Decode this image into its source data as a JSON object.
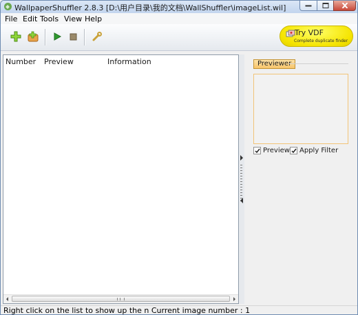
{
  "window": {
    "title": "WallpaperShuffler 2.8.3 [D:\\用户目录\\我的文档\\WallShuffler\\imageList.wil]"
  },
  "menu": {
    "items": [
      {
        "label": "File"
      },
      {
        "label": "Edit"
      },
      {
        "label": "Tools"
      },
      {
        "label": "View"
      },
      {
        "label": "Help"
      }
    ]
  },
  "toolbar": {
    "buttons": [
      {
        "icon": "add-icon"
      },
      {
        "icon": "add-folder-icon"
      },
      {
        "icon": "play-icon"
      },
      {
        "icon": "stop-icon"
      },
      {
        "icon": "wrench-icon"
      }
    ],
    "promo": {
      "title": "Try VDF",
      "subtitle": "Complete duplicate finder",
      "icon": "vdf-icon"
    }
  },
  "list": {
    "columns": [
      "Number",
      "Preview",
      "Information"
    ],
    "rows": []
  },
  "previewer": {
    "label": "Previewer",
    "checkboxes": [
      {
        "label": "Preview",
        "checked": true
      },
      {
        "label": "Apply Filter",
        "checked": true
      }
    ]
  },
  "status": {
    "text": "Right click on the list to show up the n Current image number : 1"
  },
  "colors": {
    "titlebar": "#c2d5ee",
    "promo_yellow": "#f5e400",
    "previewer_tab": "#f7c46a",
    "preview_border": "#f2c477"
  }
}
